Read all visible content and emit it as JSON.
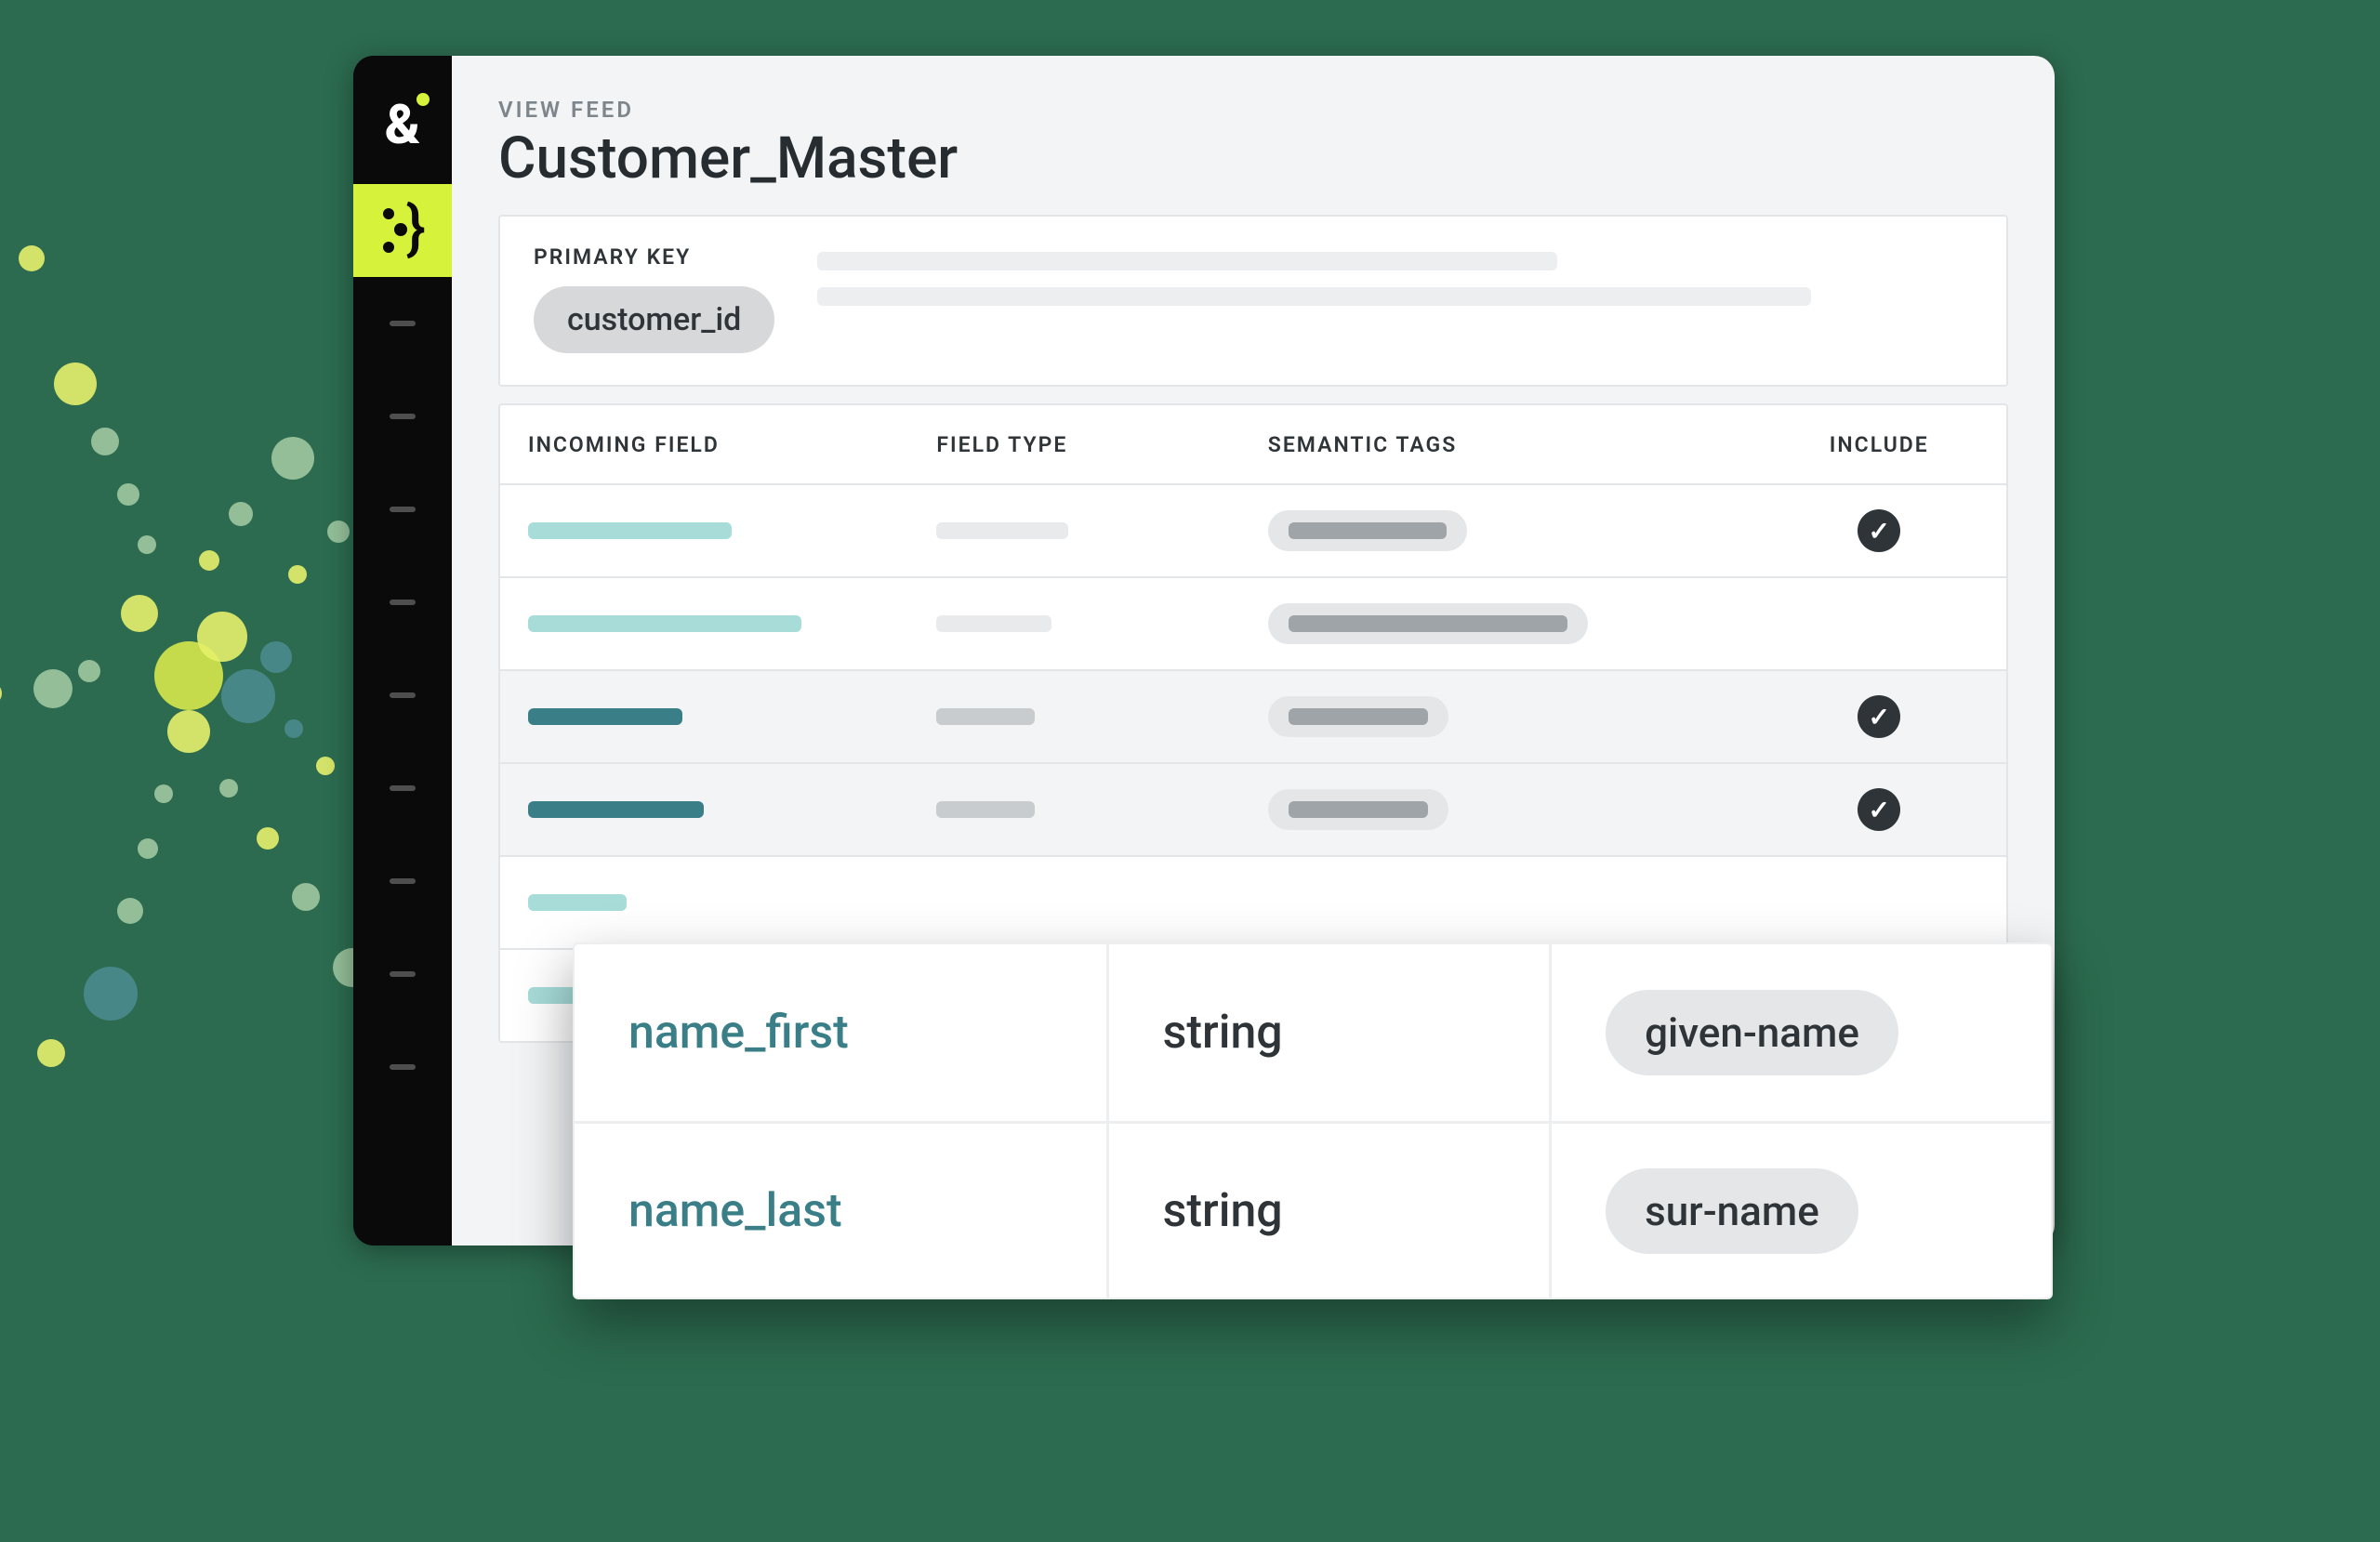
{
  "header": {
    "eyebrow": "VIEW FEED",
    "title": "Customer_Master"
  },
  "primary_key": {
    "label": "PRIMARY KEY",
    "value": "customer_id"
  },
  "columns": {
    "incoming_field": "INCOMING FIELD",
    "field_type": "FIELD TYPE",
    "semantic_tags": "SEMANTIC TAGS",
    "include": "INCLUDE"
  },
  "detail_rows": [
    {
      "field": "name_first",
      "type": "string",
      "tag": "given-name"
    },
    {
      "field": "name_last",
      "type": "string",
      "tag": "sur-name"
    }
  ],
  "colors": {
    "accent": "#d7f23b",
    "teal_light": "#a7dcd9",
    "teal_dark": "#3a7f88",
    "bg_green": "#2c6b4f"
  }
}
